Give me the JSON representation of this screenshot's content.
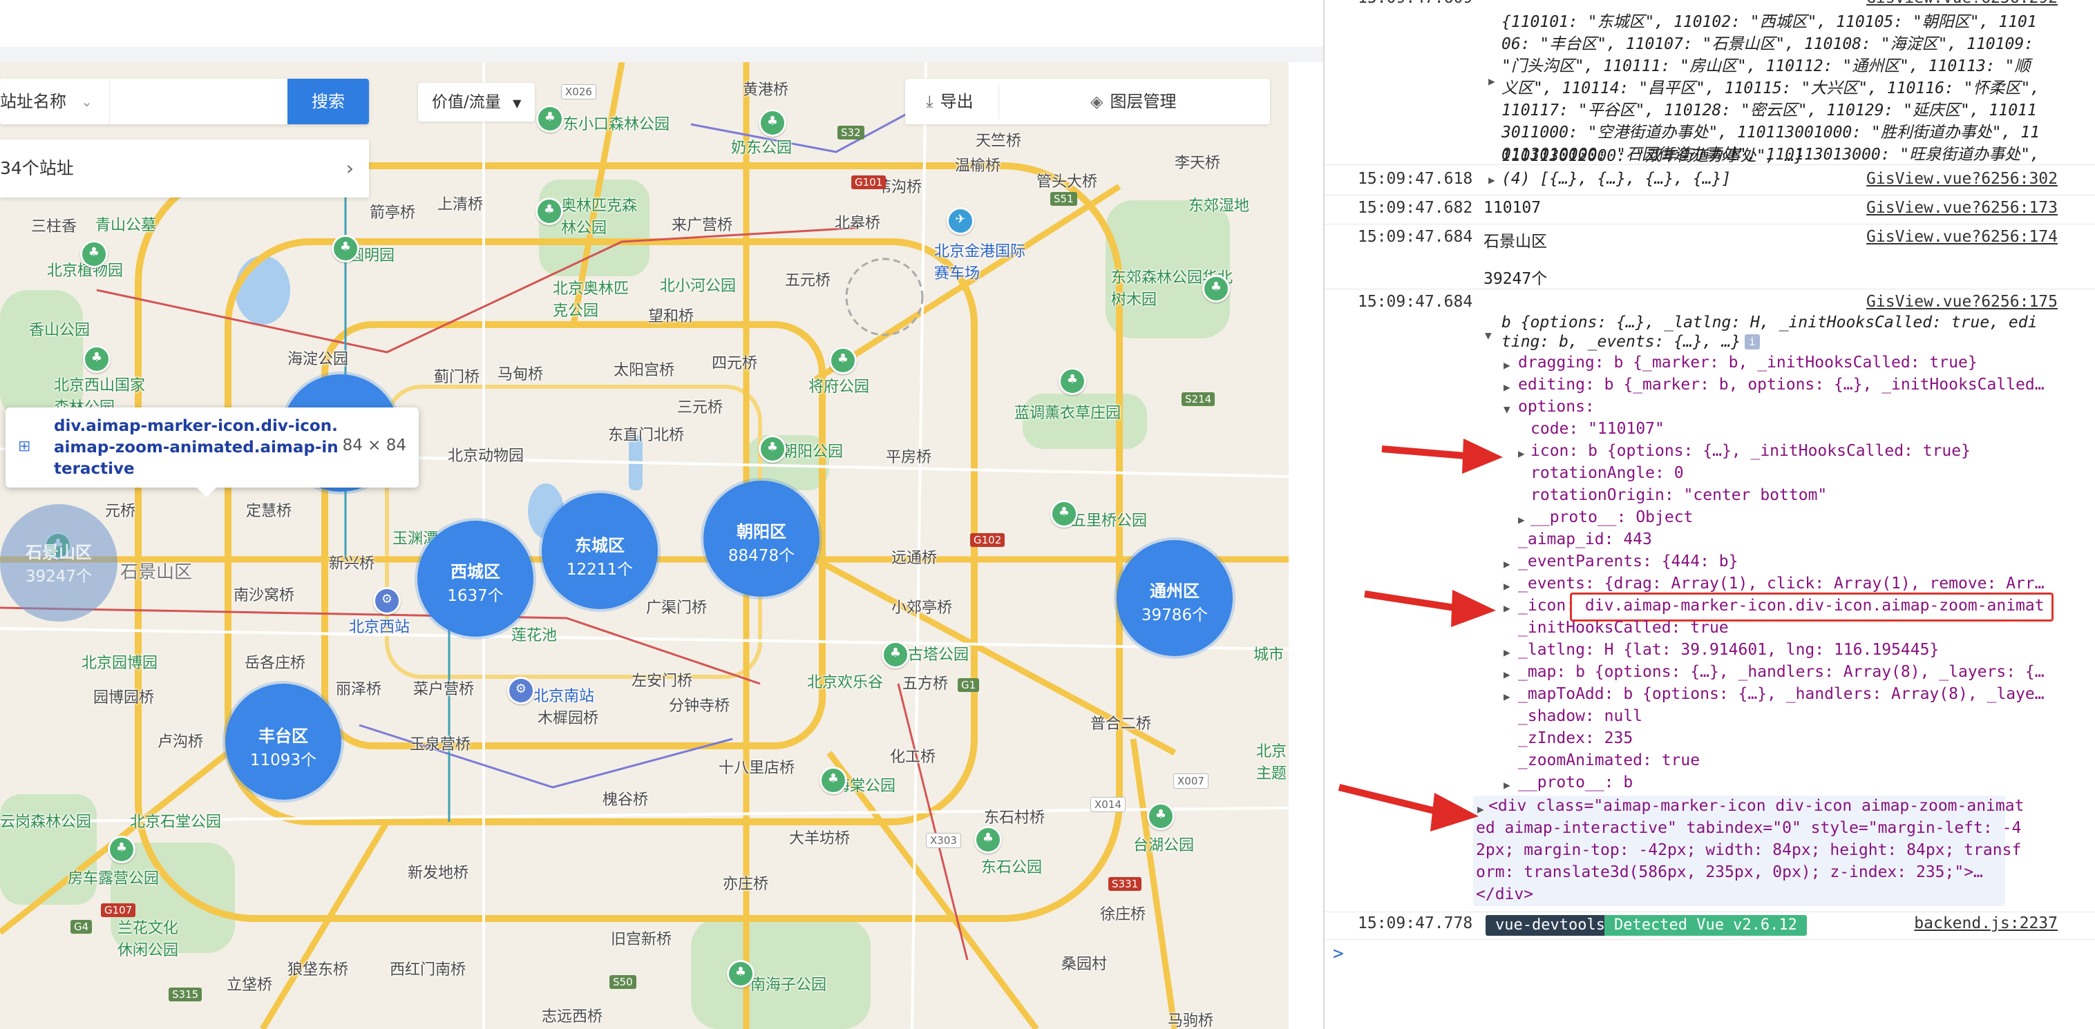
{
  "search": {
    "select_label": "站址名称",
    "search_button": "搜索",
    "value_flow": "价值/流量",
    "station_count": "34个站址",
    "export": "导出",
    "layer_mgmt": "图层管理"
  },
  "tooltip": {
    "selector": "div.aimap-marker-icon.div-icon.aimap-zoom-animated.aimap-interactive",
    "size": "84 × 84"
  },
  "clusters": [
    {
      "name": "石景山区",
      "count": "39247个"
    },
    {
      "name": "西城区",
      "count": "1637个"
    },
    {
      "name": "东城区",
      "count": "12211个"
    },
    {
      "name": "朝阳区",
      "count": "88478个"
    },
    {
      "name": "丰台区",
      "count": "11093个"
    },
    {
      "name": "通州区",
      "count": "39786个"
    }
  ],
  "map_labels": {
    "huangcunqiao": "黄港桥",
    "dongxiaokou": "东小口森林公园",
    "naichiyuan": "奶东公园",
    "tianyiqiao": "天竺桥",
    "wenyuqiao": "温榆桥",
    "lishoucunqiao": "李天桥",
    "guanjiaqiao": "管头大桥",
    "zhougouqiao": "苇沟桥",
    "beigaoqiao": "北皋桥",
    "dongjiao": "东郊森林公园",
    "sanjitang": "三柱香",
    "qingshan": "青山公墓",
    "qianfengqiao": "箭亭桥",
    "shangqing": "上清桥",
    "aolin": "奥林匹克森林公园",
    "laiguang": "来广营桥",
    "jinggang": "北京金港国际赛车场",
    "yuanmingyuan": "圆明园",
    "beijingzhiwu": "北京植物园",
    "xiangshan": "香山公园",
    "haidian": "海淀公园",
    "aolin2": "北京奥林匹克公园",
    "beixiao": "北小河公园",
    "wangjing": "望和桥",
    "wuyuan": "五元桥",
    "xishan": "北京西山国家森林公园",
    "jimen": "蓟门桥",
    "madian": "马甸桥",
    "taiyanggong": "太阳宫桥",
    "siyuan": "四元桥",
    "jiangfu": "将府公园",
    "sanyuan": "三元桥",
    "dongzhimen": "东直门北桥",
    "lantiao": "蓝调薰衣草庄园",
    "dongwuyuan": "北京动物园",
    "chaoyang": "朝阳公园",
    "pingfang": "平房桥",
    "yuanqiao": "元桥",
    "dingzhi": "定慧桥",
    "shilihe": "五里桥公园",
    "shijingshan": "石景山区",
    "xinxing": "新兴桥",
    "yuyuan": "玉渊潭",
    "yuandong": "远通桥",
    "nanshui": "南沙窝桥",
    "beijingxi": "北京西站",
    "guangqu": "广渠门桥",
    "xiaojiao": "小郊亭桥",
    "lianhuachi": "莲花池",
    "beijingyuanbo": "北京园博园",
    "yuegu": "岳各庄桥",
    "lizeqiao": "丽泽桥",
    "caihu": "菜户营桥",
    "beijingnan": "北京南站",
    "zuoan": "左安门桥",
    "beijinghuanle": "北京欢乐谷",
    "wufang": "五方桥",
    "guta": "古塔公园",
    "yuanboqiao": "园博园桥",
    "lugou": "卢沟桥",
    "yuquan": "玉泉营桥",
    "muxi": "木樨园桥",
    "fenzhong": "分钟寺桥",
    "huagong": "化工桥",
    "shibali": "十八里店桥",
    "haitang": "海棠公园",
    "tongzhou": "通州区",
    "huaiyin": "槐谷桥",
    "dayang": "大羊坊桥",
    "dongshi": "东石村桥",
    "yunshan": "云岗森林公园",
    "shicun": "北京石堂公园",
    "xingzhuang": "新发地桥",
    "yizhuang": "亦庄桥",
    "dongsi": "东石公园",
    "taihu": "台湖公园",
    "xuzhuang": "徐庄桥",
    "fangshan": "房车露营公园",
    "lanting": "兰花文化休闲公园",
    "ligou": "立垡桥",
    "langfa": "狼垡东桥",
    "xihong": "西红门南桥",
    "jiugong": "旧宫新桥",
    "nanhaizi": "南海子公园",
    "zhiyuan": "志远西桥",
    "mabei": "马驹桥",
    "putongjiang": "普合二桥",
    "chengfeng": "城市",
    "beijingzhuti": "北京主题",
    "dongjiao2": "东郊湿地",
    "huabei": "东郊森林公园华北树木园",
    "sangyuan": "桑园村"
  },
  "road_tags": [
    "X026",
    "S32",
    "G101",
    "S51",
    "S214",
    "G102",
    "G1",
    "X007",
    "X014",
    "X303",
    "S331",
    "S315",
    "S50",
    "G4",
    "G107"
  ],
  "console": {
    "row0_ts": "15:09:47.609",
    "row0_src": "GisView.vue?6256:292",
    "dict_lines": [
      "{110101: \"东城区\", 110102: \"西城区\", 110105: \"朝阳区\", 1101",
      "06: \"丰台区\", 110107: \"石景山区\", 110108: \"海淀区\", 110109:",
      "\"门头沟区\", 110111: \"房山区\", 110112: \"通州区\", 110113: \"顺",
      "义区\", 110114: \"昌平区\", 110115: \"大兴区\", 110116: \"怀柔区\",",
      "110117: \"平谷区\", 110128: \"密云区\", 110129: \"延庆区\", 11011",
      "3011000: \"空港街道办事处\", 110113001000: \"胜利街道办事处\", 11",
      "0113010000: \"石园街道办事处\", 110113013000: \"旺泉街道办事处\",",
      "110113012000: \"双丰街道办事处\", …}"
    ],
    "row1_ts": "15:09:47.618",
    "row1_text": "(4) [{…}, {…}, {…}, {…}]",
    "row1_src": "GisView.vue?6256:302",
    "row2_ts": "15:09:47.682",
    "row2_text": "110107",
    "row2_src": "GisView.vue?6256:173",
    "row3_ts": "15:09:47.684",
    "row3_text": "石景山区",
    "row3_src": "GisView.vue?6256:174",
    "row3b_text": "39247个",
    "row4_ts": "15:09:47.684",
    "row4_src": "GisView.vue?6256:175",
    "obj_head1": "b {options: {…}, _latlng: H, _initHooksCalled: true, edi",
    "obj_head2": "ting: b, _events: {…}, …}",
    "obj_lines": [
      "dragging: b {_marker: b, _initHooksCalled: true}",
      "editing: b {_marker: b, options: {…}, _initHooksCalled…",
      "options:",
      "code: \"110107\"",
      "icon: b {options: {…}, _initHooksCalled: true}",
      "rotationAngle: 0",
      "rotationOrigin: \"center bottom\"",
      "__proto__: Object",
      "_aimap_id: 443",
      "_eventParents: {444: b}",
      "_events: {drag: Array(1), click: Array(1), remove: Arr…",
      "_icon: div.aimap-marker-icon.div-icon.aimap-zoom-animat",
      "_initHooksCalled: true",
      "_latlng: H {lat: 39.914601, lng: 116.195445}",
      "_map: b {options: {…}, _handlers: Array(8), _layers: {…",
      "_mapToAdd: b {options: {…}, _handlers: Array(8), _laye…",
      "_shadow: null",
      "_zIndex: 235",
      "_zoomAnimated: true",
      "__proto__: b"
    ],
    "html_lines": [
      "<div class=\"aimap-marker-icon div-icon aimap-zoom-animat",
      "ed aimap-interactive\" tabindex=\"0\" style=\"margin-left: -4",
      "2px; margin-top: -42px; width: 84px; height: 84px; transf",
      "orm: translate3d(586px, 235px, 0px); z-index: 235;\">…",
      "</div>"
    ],
    "row5_ts": "15:09:47.778",
    "badge_left": "vue-devtools",
    "badge_right": "Detected Vue v2.6.12",
    "row5_src": "backend.js:2237",
    "prompt": ">"
  }
}
